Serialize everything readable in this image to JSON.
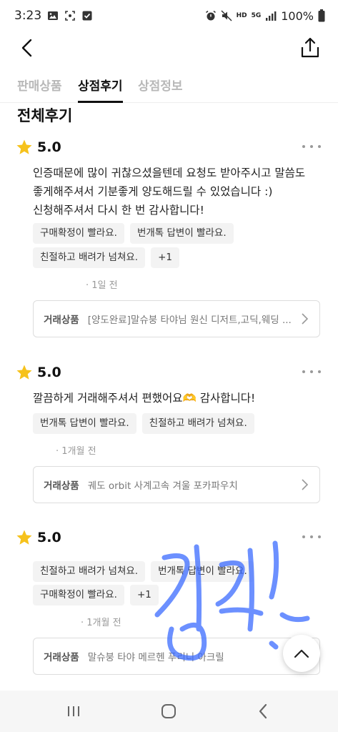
{
  "status_bar": {
    "time": "3:23",
    "network": "5G",
    "hd_label": "HD",
    "battery": "100%"
  },
  "tabs": [
    {
      "label": "판매상품",
      "active": false
    },
    {
      "label": "상점후기",
      "active": true
    },
    {
      "label": "상점정보",
      "active": false
    }
  ],
  "section_title": "전체후기",
  "reviews": [
    {
      "rating": "5.0",
      "text_lines": [
        "인증때문에 많이 귀찮으셨을텐데 요청도 받아주시고 말씀도",
        "좋게해주셔서 기분좋게 양도해드릴 수 있었습니다 :)",
        "신청해주셔서 다시 한 번 감사합니다!"
      ],
      "tags_row1": [
        "구매확정이 빨라요.",
        "번개톡 답변이 빨라요."
      ],
      "tags_row2": [
        "친절하고 배려가 넘쳐요.",
        "+1"
      ],
      "time": "1일 전",
      "product_label": "거래상품",
      "product_name": "[양도완료]말슈붕 타야님 원신 디저트,고딕,웨딩 ..."
    },
    {
      "rating": "5.0",
      "text_lines": [
        "깔끔하게 거래해주셔서 편했어요🫶 감사합니다!"
      ],
      "tags_row1": [
        "번개톡 답변이 빨라요.",
        "친절하고 배려가 넘쳐요."
      ],
      "time": "1개월 전",
      "product_label": "거래상품",
      "product_name": "궤도 orbit 사계고속 겨울 포카파우치"
    },
    {
      "rating": "5.0",
      "tags_row1": [
        "친절하고 배려가 넘쳐요.",
        "번개톡 답변이 빨라요."
      ],
      "tags_row2": [
        "구매확정이 빨라요.",
        "+1"
      ],
      "time": "1개월 전",
      "product_label": "거래상품",
      "product_name": "말슈붕 타야 메르헨 푸리니 아크릴"
    }
  ],
  "colors": {
    "star": "#F6C21C",
    "tab_active": "#111111",
    "tab_inactive": "#B8B8B8",
    "tag_bg": "#F3F3F3",
    "signature": "#3B6CFF"
  },
  "icons": {
    "back": "chevron-left-icon",
    "share": "share-icon",
    "more": "more-dots-icon",
    "product_arrow": "chevron-right-icon",
    "scroll_top": "chevron-up-icon"
  }
}
